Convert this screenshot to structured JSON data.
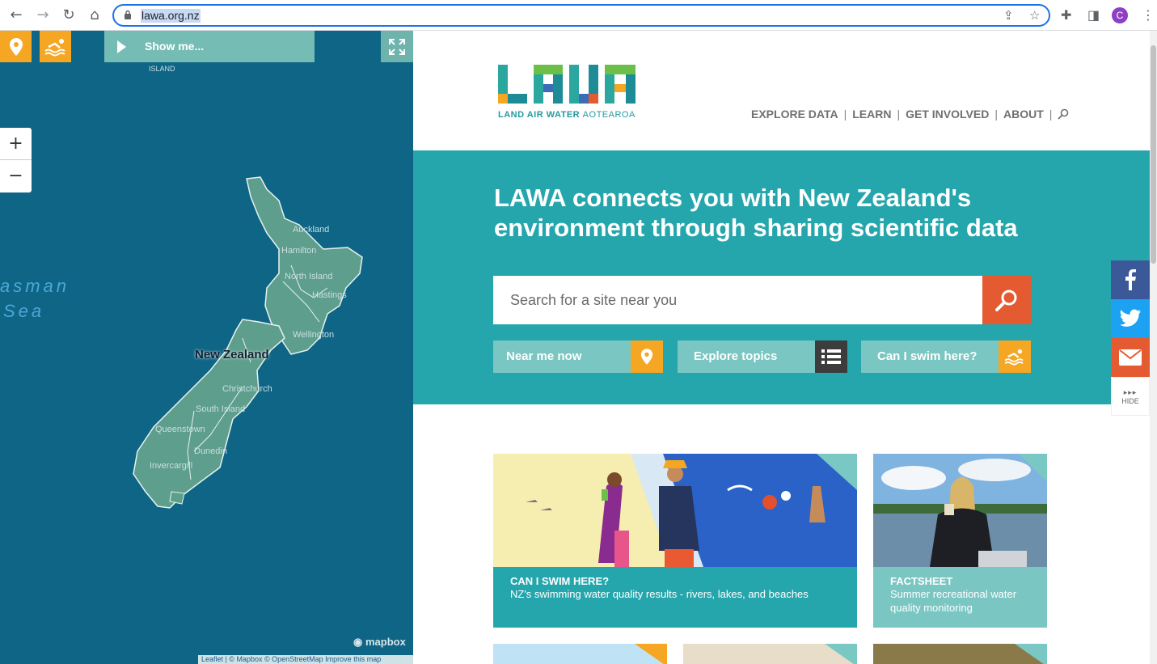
{
  "browser": {
    "url": "lawa.org.nz",
    "avatar_initial": "C"
  },
  "map": {
    "show_me_label": "Show me...",
    "zoom_in": "+",
    "zoom_out": "−",
    "sea_label_line1": "asman",
    "sea_label_line2": "Sea",
    "island_label": "ISLAND",
    "country_label": "New Zealand",
    "cities": [
      "Auckland",
      "Hamilton",
      "North Island",
      "Hastings",
      "Wellington",
      "Christchurch",
      "South Island",
      "Queenstown",
      "Dunedin",
      "Invercargill"
    ],
    "mapbox_label": "mapbox",
    "attribution": "Leaflet | © Mapbox © OpenStreetMap Improve this map"
  },
  "site": {
    "logo_letters": "LAWA",
    "logo_tagline_bold": "LAND AIR WATER",
    "logo_tagline_light": "AOTEAROA",
    "nav": [
      "EXPLORE DATA",
      "LEARN",
      "GET INVOLVED",
      "ABOUT"
    ],
    "hero_title": "LAWA connects you with New Zealand's environment through sharing scientific data",
    "search_placeholder": "Search for a site near you",
    "quick_links": [
      {
        "label": "Near me now",
        "icon": "location-pin-icon"
      },
      {
        "label": "Explore topics",
        "icon": "list-icon"
      },
      {
        "label": "Can I swim here?",
        "icon": "swimmer-icon"
      }
    ],
    "cards": [
      {
        "title": "CAN I SWIM HERE?",
        "desc": "NZ's swimming water quality results - rivers, lakes, and beaches"
      },
      {
        "title": "FACTSHEET",
        "desc": "Summer recreational water quality monitoring"
      }
    ]
  },
  "social": {
    "hide_label": "HIDE"
  },
  "colors": {
    "teal": "#25a6ac",
    "orange": "#f5a623",
    "red": "#e45b31",
    "map_sea": "#0f6585"
  }
}
